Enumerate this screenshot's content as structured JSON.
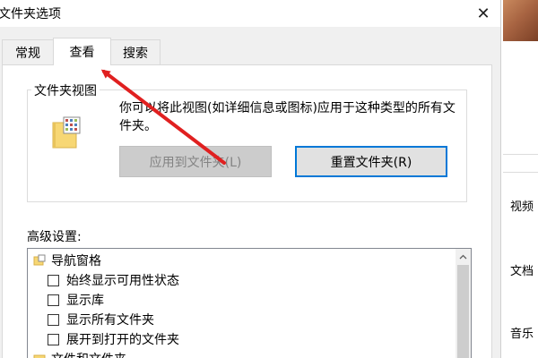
{
  "dialog": {
    "title": "文件夹选项",
    "close_glyph": "✕",
    "tabs": [
      {
        "label": "常规",
        "active": false
      },
      {
        "label": "查看",
        "active": true
      },
      {
        "label": "搜索",
        "active": false
      }
    ],
    "folder_views": {
      "legend": "文件夹视图",
      "description": "你可以将此视图(如详细信息或图标)应用于这种类型的所有文件夹。",
      "apply_button": "应用到文件夹(L)",
      "reset_button": "重置文件夹(R)"
    },
    "advanced": {
      "label": "高级设置:",
      "items": [
        {
          "type": "group",
          "label": "导航窗格"
        },
        {
          "type": "checkbox",
          "label": "始终显示可用性状态",
          "checked": false
        },
        {
          "type": "checkbox",
          "label": "显示库",
          "checked": false
        },
        {
          "type": "checkbox",
          "label": "显示所有文件夹",
          "checked": false
        },
        {
          "type": "checkbox",
          "label": "展开到打开的文件夹",
          "checked": false
        },
        {
          "type": "group",
          "label": "文件和文件夹"
        }
      ]
    }
  },
  "background_window": {
    "nav_items": [
      "视频",
      "文档",
      "音乐"
    ]
  },
  "colors": {
    "annotation_arrow": "#e02020",
    "focus_border": "#0078d7",
    "folder_yellow": "#f7d774"
  }
}
